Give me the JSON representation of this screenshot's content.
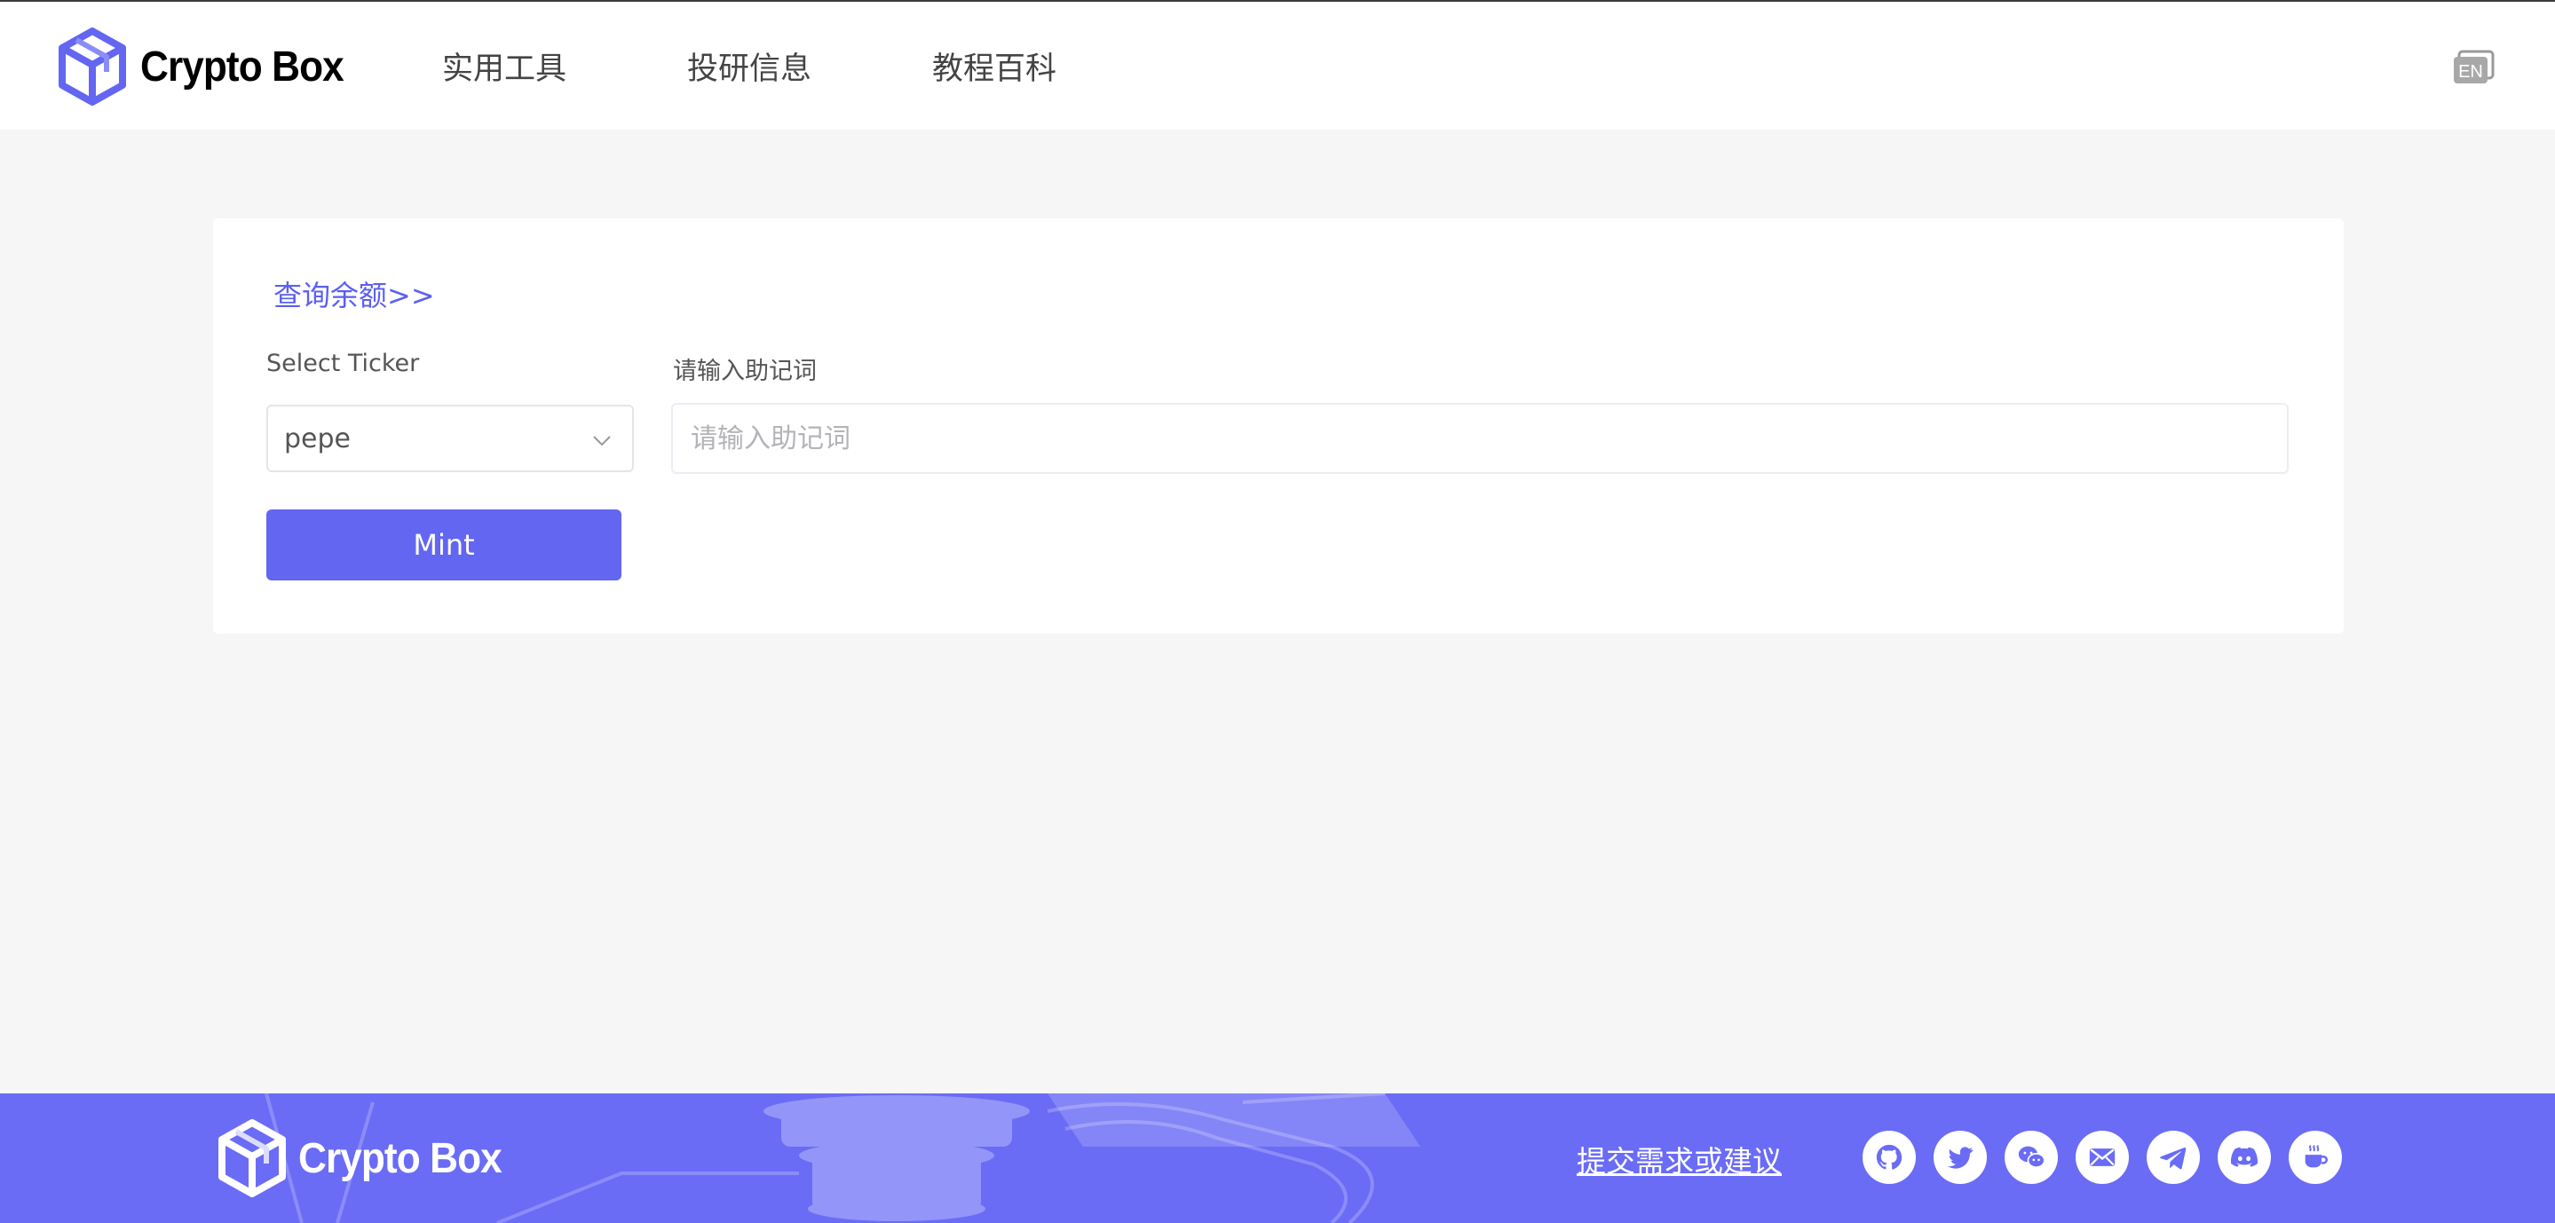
{
  "header": {
    "brand": "Crypto Box",
    "nav": [
      {
        "label": "实用工具"
      },
      {
        "label": "投研信息"
      },
      {
        "label": "教程百科"
      }
    ],
    "language_icon": "en-language-icon",
    "language_label": "EN"
  },
  "main": {
    "balance_link": "查询余额>>",
    "ticker": {
      "label": "Select Ticker",
      "selected": "pepe"
    },
    "mnemonic": {
      "label": "请输入助记词",
      "placeholder": "请输入助记词",
      "value": ""
    },
    "mint_label": "Mint"
  },
  "footer": {
    "brand": "Crypto Box",
    "feedback_link": "提交需求或建议",
    "social_icons": [
      "github-icon",
      "twitter-icon",
      "wechat-icon",
      "mail-icon",
      "telegram-icon",
      "discord-icon",
      "coffee-icon"
    ]
  },
  "colors": {
    "accent": "#6366f1",
    "footer_bg": "#6a6cf6",
    "page_bg": "#f6f6f6",
    "link": "#5b5ff0"
  }
}
